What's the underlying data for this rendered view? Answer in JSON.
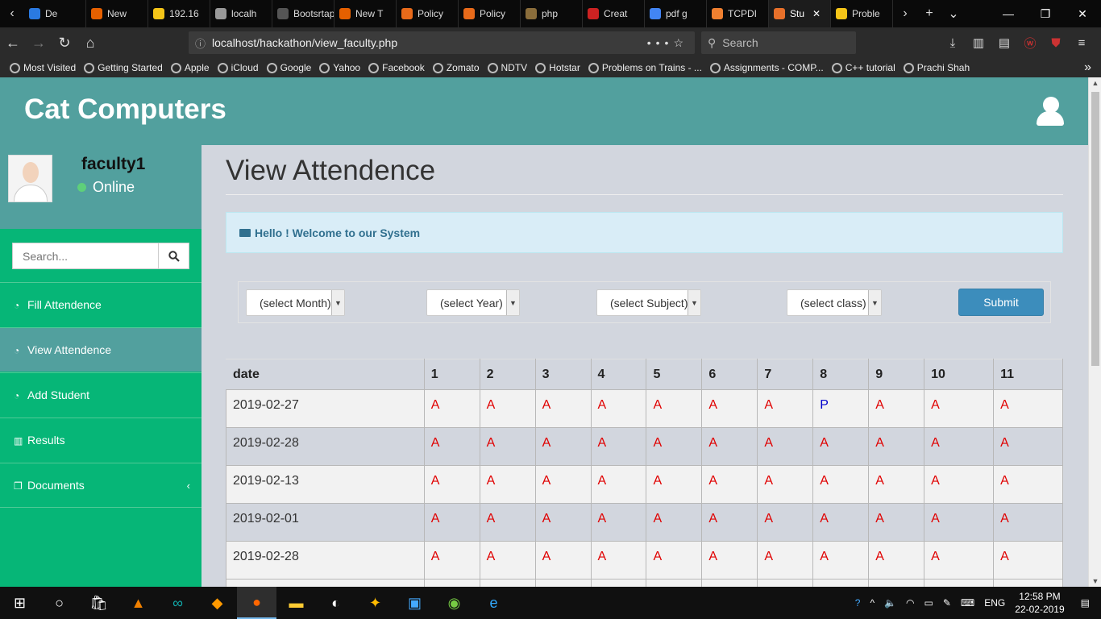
{
  "browser": {
    "tabs": [
      {
        "label": "De",
        "color": "#2a7ae2"
      },
      {
        "label": "New",
        "color": "#e66000"
      },
      {
        "label": "192.16",
        "color": "#f5c518"
      },
      {
        "label": "localh",
        "color": "#999999"
      },
      {
        "label": "Bootsrtap",
        "color": "#555555"
      },
      {
        "label": "New T",
        "color": "#e66000"
      },
      {
        "label": "Policy",
        "color": "#e86a1a"
      },
      {
        "label": "Policy",
        "color": "#e86a1a"
      },
      {
        "label": "php",
        "color": "#8a6d3b"
      },
      {
        "label": "Creat",
        "color": "#cc2222"
      },
      {
        "label": "pdf g",
        "color": "#4285f4"
      },
      {
        "label": "TCPDI",
        "color": "#f08030"
      },
      {
        "label": "Stu",
        "color": "#e8702a"
      },
      {
        "label": "Proble",
        "color": "#f5c518"
      }
    ],
    "url": "localhost/hackathon/view_faculty.php",
    "search_placeholder": "Search",
    "bookmarks": [
      "Most Visited",
      "Getting Started",
      "Apple",
      "iCloud",
      "Google",
      "Yahoo",
      "Facebook",
      "Zomato",
      "NDTV",
      "Hotstar",
      "Problems on Trains - ...",
      "Assignments - COMP...",
      "C++ tutorial",
      "Prachi Shah"
    ]
  },
  "app": {
    "brand": "Cat Computers",
    "user": {
      "name": "faculty1",
      "status": "Online"
    },
    "search_placeholder": "Search...",
    "menu": [
      {
        "label": "Fill Attendence",
        "icon": "dashboard-icon"
      },
      {
        "label": "View Attendence",
        "icon": "dashboard-icon"
      },
      {
        "label": "Add Student",
        "icon": "dashboard-icon"
      },
      {
        "label": "Results",
        "icon": "bar-chart-icon"
      },
      {
        "label": "Documents",
        "icon": "copy-icon"
      }
    ],
    "page_title": "View Attendence",
    "callout": "Hello ! Welcome to our System",
    "filters": {
      "month": "(select Month)",
      "year": "(select Year)",
      "subject": "(select Subject)",
      "class": "(select class)",
      "submit": "Submit"
    },
    "table": {
      "headers": [
        "date",
        "1",
        "2",
        "3",
        "4",
        "5",
        "6",
        "7",
        "8",
        "9",
        "10",
        "11"
      ],
      "rows": [
        {
          "date": "2019-02-27",
          "values": [
            "A",
            "A",
            "A",
            "A",
            "A",
            "A",
            "A",
            "P",
            "A",
            "A",
            "A"
          ]
        },
        {
          "date": "2019-02-28",
          "values": [
            "A",
            "A",
            "A",
            "A",
            "A",
            "A",
            "A",
            "A",
            "A",
            "A",
            "A"
          ]
        },
        {
          "date": "2019-02-13",
          "values": [
            "A",
            "A",
            "A",
            "A",
            "A",
            "A",
            "A",
            "A",
            "A",
            "A",
            "A"
          ]
        },
        {
          "date": "2019-02-01",
          "values": [
            "A",
            "A",
            "A",
            "A",
            "A",
            "A",
            "A",
            "A",
            "A",
            "A",
            "A"
          ]
        },
        {
          "date": "2019-02-28",
          "values": [
            "A",
            "A",
            "A",
            "A",
            "A",
            "A",
            "A",
            "A",
            "A",
            "A",
            "A"
          ]
        }
      ]
    }
  },
  "taskbar": {
    "lang": "ENG",
    "time": "12:58 PM",
    "date": "22-02-2019"
  }
}
